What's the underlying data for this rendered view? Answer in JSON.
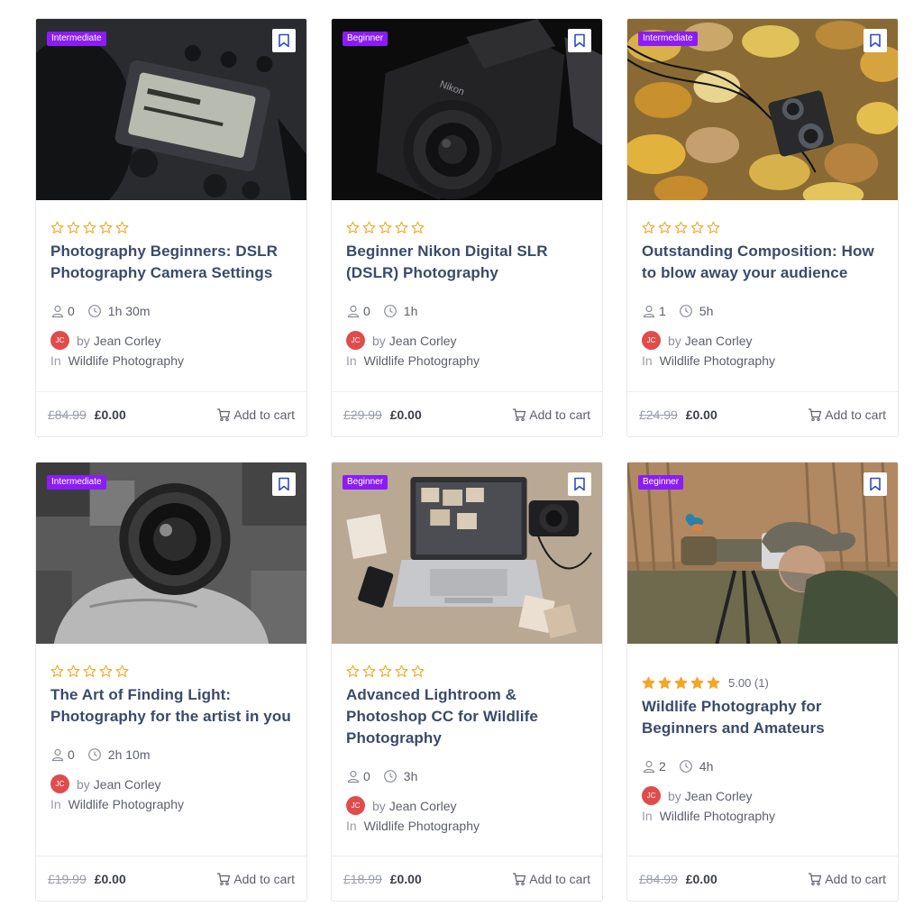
{
  "colors": {
    "badge": "#8b1cf6",
    "star": "#f5a623",
    "title": "#3a4a6b",
    "avatar": "#e04c4c"
  },
  "courses": [
    {
      "level": "Intermediate",
      "rating_value": 0,
      "rating_text": "",
      "title": "Photography Beginners: DSLR Photography Camera Settings",
      "students": "0",
      "duration": "1h 30m",
      "avatar_initials": "JC",
      "by_label": "by",
      "author": "Jean Corley",
      "in_label": "In",
      "category": "Wildlife Photography",
      "old_price": "£84.99",
      "price": "£0.00",
      "cart_label": "Add to cart",
      "image": "camera-lcd"
    },
    {
      "level": "Beginner",
      "rating_value": 0,
      "rating_text": "",
      "title": "Beginner Nikon Digital SLR (DSLR) Photography",
      "students": "0",
      "duration": "1h",
      "avatar_initials": "JC",
      "by_label": "by",
      "author": "Jean Corley",
      "in_label": "In",
      "category": "Wildlife Photography",
      "old_price": "£29.99",
      "price": "£0.00",
      "cart_label": "Add to cart",
      "image": "nikon-camera"
    },
    {
      "level": "Intermediate",
      "rating_value": 0,
      "rating_text": "",
      "title": "Outstanding Composition: How to blow away your audience",
      "students": "1",
      "duration": "5h",
      "avatar_initials": "JC",
      "by_label": "by",
      "author": "Jean Corley",
      "in_label": "In",
      "category": "Wildlife Photography",
      "old_price": "£24.99",
      "price": "£0.00",
      "cart_label": "Add to cart",
      "image": "camera-on-leaves"
    },
    {
      "level": "Intermediate",
      "rating_value": 0,
      "rating_text": "",
      "title": "The Art of Finding Light: Photography for the artist in you",
      "students": "0",
      "duration": "2h 10m",
      "avatar_initials": "JC",
      "by_label": "by",
      "author": "Jean Corley",
      "in_label": "In",
      "category": "Wildlife Photography",
      "old_price": "£19.99",
      "price": "£0.00",
      "cart_label": "Add to cart",
      "image": "lens-in-hand"
    },
    {
      "level": "Beginner",
      "rating_value": 0,
      "rating_text": "",
      "title": "Advanced Lightroom & Photoshop CC for Wildlife Photography",
      "students": "0",
      "duration": "3h",
      "avatar_initials": "JC",
      "by_label": "by",
      "author": "Jean Corley",
      "in_label": "In",
      "category": "Wildlife Photography",
      "old_price": "£18.99",
      "price": "£0.00",
      "cart_label": "Add to cart",
      "image": "laptop-desk"
    },
    {
      "level": "Beginner",
      "rating_value": 5,
      "rating_text": "5.00 (1)",
      "title": "Wildlife Photography for Beginners and Amateurs",
      "students": "2",
      "duration": "4h",
      "avatar_initials": "JC",
      "by_label": "by",
      "author": "Jean Corley",
      "in_label": "In",
      "category": "Wildlife Photography",
      "old_price": "£84.99",
      "price": "£0.00",
      "cart_label": "Add to cart",
      "image": "photographer-kingfisher"
    }
  ]
}
